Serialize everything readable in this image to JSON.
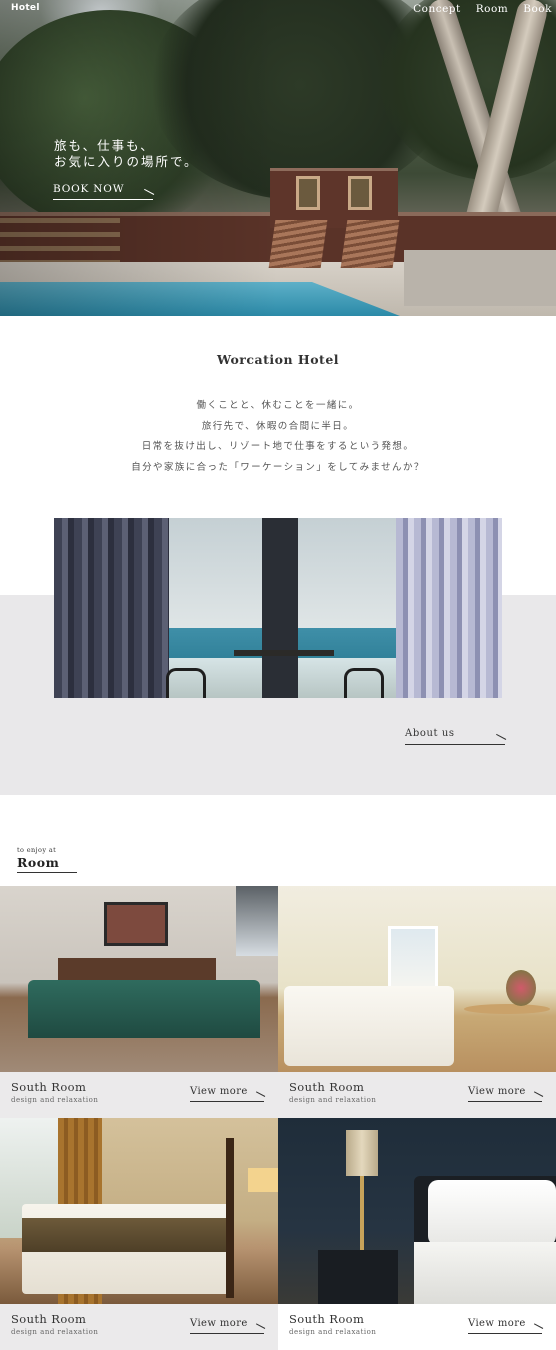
{
  "header": {
    "brand": "Hotel",
    "nav": [
      "Concept",
      "Room",
      "Book"
    ]
  },
  "hero": {
    "line1": "旅も、仕事も、",
    "line2": "お気に入りの場所で。",
    "cta": "BOOK NOW"
  },
  "intro": {
    "title": "Worcation Hotel",
    "lines": [
      "働くことと、休むことを一緒に。",
      "旅行先で、休暇の合間に半日。",
      "日常を抜け出し、リゾート地で仕事をするという発想。",
      "自分や家族に合った「ワーケーション」をしてみませんか？"
    ]
  },
  "about": {
    "link": "About us"
  },
  "rooms_section": {
    "kicker": "to enjoy at",
    "heading": "Room"
  },
  "rooms": [
    {
      "title": "South Room",
      "subtitle": "design and relaxation",
      "link": "View more"
    },
    {
      "title": "South Room",
      "subtitle": "design and relaxation",
      "link": "View more"
    },
    {
      "title": "South Room",
      "subtitle": "design and relaxation",
      "link": "View more"
    },
    {
      "title": "South Room",
      "subtitle": "design and relaxation",
      "link": "View more"
    }
  ]
}
